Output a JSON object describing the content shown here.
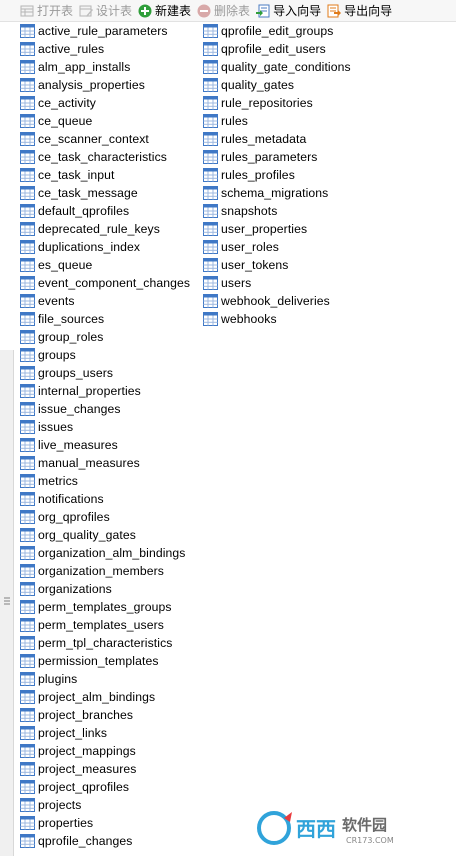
{
  "toolbar": {
    "open_table": "打开表",
    "design_table": "设计表",
    "new_table": "新建表",
    "delete_table": "删除表",
    "import_wizard": "导入向导",
    "export_wizard": "导出向导"
  },
  "tables_left": [
    "active_rule_parameters",
    "active_rules",
    "alm_app_installs",
    "analysis_properties",
    "ce_activity",
    "ce_queue",
    "ce_scanner_context",
    "ce_task_characteristics",
    "ce_task_input",
    "ce_task_message",
    "default_qprofiles",
    "deprecated_rule_keys",
    "duplications_index",
    "es_queue",
    "event_component_changes",
    "events",
    "file_sources",
    "group_roles",
    "groups",
    "groups_users",
    "internal_properties",
    "issue_changes",
    "issues",
    "live_measures",
    "manual_measures",
    "metrics",
    "notifications",
    "org_qprofiles",
    "org_quality_gates",
    "organization_alm_bindings",
    "organization_members",
    "organizations",
    "perm_templates_groups",
    "perm_templates_users",
    "perm_tpl_characteristics",
    "permission_templates",
    "plugins",
    "project_alm_bindings",
    "project_branches",
    "project_links",
    "project_mappings",
    "project_measures",
    "project_qprofiles",
    "projects",
    "properties",
    "qprofile_changes"
  ],
  "tables_right": [
    "qprofile_edit_groups",
    "qprofile_edit_users",
    "quality_gate_conditions",
    "quality_gates",
    "rule_repositories",
    "rules",
    "rules_metadata",
    "rules_parameters",
    "rules_profiles",
    "schema_migrations",
    "snapshots",
    "user_properties",
    "user_roles",
    "user_tokens",
    "users",
    "webhook_deliveries",
    "webhooks"
  ],
  "watermark": {
    "brand": "西西",
    "site_name": "软件园",
    "url": "CR173.COM"
  },
  "colors": {
    "icon_blue": "#3f78c6",
    "new_table_green": "#2f9e3a",
    "disabled_gray": "#9a9a9a",
    "export_orange": "#e07b1a"
  }
}
